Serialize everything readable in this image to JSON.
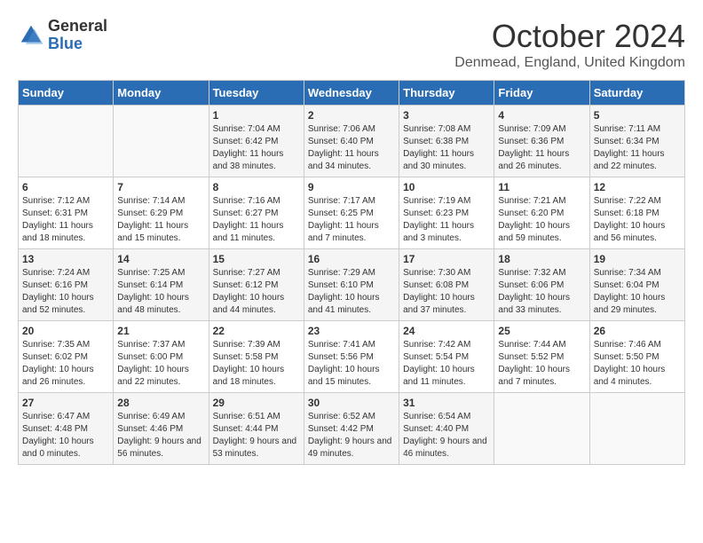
{
  "header": {
    "logo_general": "General",
    "logo_blue": "Blue",
    "month_title": "October 2024",
    "location": "Denmead, England, United Kingdom"
  },
  "days_of_week": [
    "Sunday",
    "Monday",
    "Tuesday",
    "Wednesday",
    "Thursday",
    "Friday",
    "Saturday"
  ],
  "weeks": [
    [
      {
        "day": "",
        "info": ""
      },
      {
        "day": "",
        "info": ""
      },
      {
        "day": "1",
        "info": "Sunrise: 7:04 AM\nSunset: 6:42 PM\nDaylight: 11 hours and 38 minutes."
      },
      {
        "day": "2",
        "info": "Sunrise: 7:06 AM\nSunset: 6:40 PM\nDaylight: 11 hours and 34 minutes."
      },
      {
        "day": "3",
        "info": "Sunrise: 7:08 AM\nSunset: 6:38 PM\nDaylight: 11 hours and 30 minutes."
      },
      {
        "day": "4",
        "info": "Sunrise: 7:09 AM\nSunset: 6:36 PM\nDaylight: 11 hours and 26 minutes."
      },
      {
        "day": "5",
        "info": "Sunrise: 7:11 AM\nSunset: 6:34 PM\nDaylight: 11 hours and 22 minutes."
      }
    ],
    [
      {
        "day": "6",
        "info": "Sunrise: 7:12 AM\nSunset: 6:31 PM\nDaylight: 11 hours and 18 minutes."
      },
      {
        "day": "7",
        "info": "Sunrise: 7:14 AM\nSunset: 6:29 PM\nDaylight: 11 hours and 15 minutes."
      },
      {
        "day": "8",
        "info": "Sunrise: 7:16 AM\nSunset: 6:27 PM\nDaylight: 11 hours and 11 minutes."
      },
      {
        "day": "9",
        "info": "Sunrise: 7:17 AM\nSunset: 6:25 PM\nDaylight: 11 hours and 7 minutes."
      },
      {
        "day": "10",
        "info": "Sunrise: 7:19 AM\nSunset: 6:23 PM\nDaylight: 11 hours and 3 minutes."
      },
      {
        "day": "11",
        "info": "Sunrise: 7:21 AM\nSunset: 6:20 PM\nDaylight: 10 hours and 59 minutes."
      },
      {
        "day": "12",
        "info": "Sunrise: 7:22 AM\nSunset: 6:18 PM\nDaylight: 10 hours and 56 minutes."
      }
    ],
    [
      {
        "day": "13",
        "info": "Sunrise: 7:24 AM\nSunset: 6:16 PM\nDaylight: 10 hours and 52 minutes."
      },
      {
        "day": "14",
        "info": "Sunrise: 7:25 AM\nSunset: 6:14 PM\nDaylight: 10 hours and 48 minutes."
      },
      {
        "day": "15",
        "info": "Sunrise: 7:27 AM\nSunset: 6:12 PM\nDaylight: 10 hours and 44 minutes."
      },
      {
        "day": "16",
        "info": "Sunrise: 7:29 AM\nSunset: 6:10 PM\nDaylight: 10 hours and 41 minutes."
      },
      {
        "day": "17",
        "info": "Sunrise: 7:30 AM\nSunset: 6:08 PM\nDaylight: 10 hours and 37 minutes."
      },
      {
        "day": "18",
        "info": "Sunrise: 7:32 AM\nSunset: 6:06 PM\nDaylight: 10 hours and 33 minutes."
      },
      {
        "day": "19",
        "info": "Sunrise: 7:34 AM\nSunset: 6:04 PM\nDaylight: 10 hours and 29 minutes."
      }
    ],
    [
      {
        "day": "20",
        "info": "Sunrise: 7:35 AM\nSunset: 6:02 PM\nDaylight: 10 hours and 26 minutes."
      },
      {
        "day": "21",
        "info": "Sunrise: 7:37 AM\nSunset: 6:00 PM\nDaylight: 10 hours and 22 minutes."
      },
      {
        "day": "22",
        "info": "Sunrise: 7:39 AM\nSunset: 5:58 PM\nDaylight: 10 hours and 18 minutes."
      },
      {
        "day": "23",
        "info": "Sunrise: 7:41 AM\nSunset: 5:56 PM\nDaylight: 10 hours and 15 minutes."
      },
      {
        "day": "24",
        "info": "Sunrise: 7:42 AM\nSunset: 5:54 PM\nDaylight: 10 hours and 11 minutes."
      },
      {
        "day": "25",
        "info": "Sunrise: 7:44 AM\nSunset: 5:52 PM\nDaylight: 10 hours and 7 minutes."
      },
      {
        "day": "26",
        "info": "Sunrise: 7:46 AM\nSunset: 5:50 PM\nDaylight: 10 hours and 4 minutes."
      }
    ],
    [
      {
        "day": "27",
        "info": "Sunrise: 6:47 AM\nSunset: 4:48 PM\nDaylight: 10 hours and 0 minutes."
      },
      {
        "day": "28",
        "info": "Sunrise: 6:49 AM\nSunset: 4:46 PM\nDaylight: 9 hours and 56 minutes."
      },
      {
        "day": "29",
        "info": "Sunrise: 6:51 AM\nSunset: 4:44 PM\nDaylight: 9 hours and 53 minutes."
      },
      {
        "day": "30",
        "info": "Sunrise: 6:52 AM\nSunset: 4:42 PM\nDaylight: 9 hours and 49 minutes."
      },
      {
        "day": "31",
        "info": "Sunrise: 6:54 AM\nSunset: 4:40 PM\nDaylight: 9 hours and 46 minutes."
      },
      {
        "day": "",
        "info": ""
      },
      {
        "day": "",
        "info": ""
      }
    ]
  ]
}
